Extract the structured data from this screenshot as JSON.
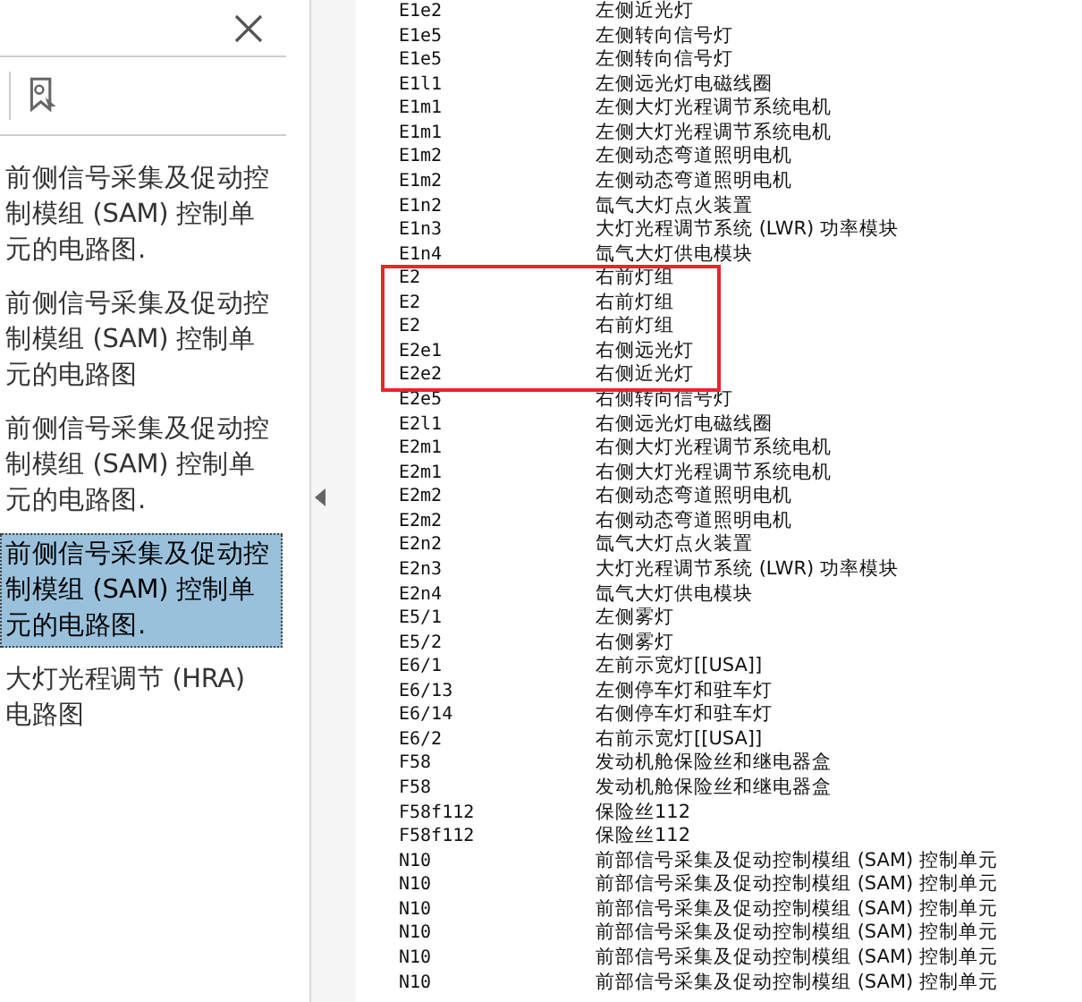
{
  "bookmarks_panel": {
    "items": [
      {
        "label": "前侧信号采集及促动控制模组 (SAM) 控制单元的电路图.",
        "selected": false
      },
      {
        "label": "前侧信号采集及促动控制模组 (SAM) 控制单元的电路图",
        "selected": false
      },
      {
        "label": "前侧信号采集及促动控制模组 (SAM) 控制单元的电路图.",
        "selected": false
      },
      {
        "label": "前侧信号采集及促动控制模组 (SAM) 控制单元的电路图.",
        "selected": true
      },
      {
        "label": "大灯光程调节 (HRA) 电路图",
        "selected": false
      }
    ]
  },
  "document": {
    "rows": [
      {
        "code": "E1e2",
        "name": "左侧近光灯",
        "highlighted": false
      },
      {
        "code": "E1e5",
        "name": "左侧转向信号灯",
        "highlighted": false
      },
      {
        "code": "E1e5",
        "name": "左侧转向信号灯",
        "highlighted": false
      },
      {
        "code": "E1l1",
        "name": "左侧远光灯电磁线圈",
        "highlighted": false
      },
      {
        "code": "E1m1",
        "name": "左侧大灯光程调节系统电机",
        "highlighted": false
      },
      {
        "code": "E1m1",
        "name": "左侧大灯光程调节系统电机",
        "highlighted": false
      },
      {
        "code": "E1m2",
        "name": "左侧动态弯道照明电机",
        "highlighted": false
      },
      {
        "code": "E1m2",
        "name": "左侧动态弯道照明电机",
        "highlighted": false
      },
      {
        "code": "E1n2",
        "name": "氙气大灯点火装置",
        "highlighted": false
      },
      {
        "code": "E1n3",
        "name": "大灯光程调节系统 (LWR) 功率模块",
        "highlighted": false
      },
      {
        "code": "E1n4",
        "name": "氙气大灯供电模块",
        "highlighted": false
      },
      {
        "code": "E2",
        "name": "右前灯组",
        "highlighted": true
      },
      {
        "code": "E2",
        "name": "右前灯组",
        "highlighted": true
      },
      {
        "code": "E2",
        "name": "右前灯组",
        "highlighted": true
      },
      {
        "code": "E2e1",
        "name": "右侧远光灯",
        "highlighted": true
      },
      {
        "code": "E2e2",
        "name": "右侧近光灯",
        "highlighted": true
      },
      {
        "code": "E2e5",
        "name": "右侧转向信号灯",
        "highlighted": false
      },
      {
        "code": "E2l1",
        "name": "右侧远光灯电磁线圈",
        "highlighted": false
      },
      {
        "code": "E2m1",
        "name": "右侧大灯光程调节系统电机",
        "highlighted": false
      },
      {
        "code": "E2m1",
        "name": "右侧大灯光程调节系统电机",
        "highlighted": false
      },
      {
        "code": "E2m2",
        "name": "右侧动态弯道照明电机",
        "highlighted": false
      },
      {
        "code": "E2m2",
        "name": "右侧动态弯道照明电机",
        "highlighted": false
      },
      {
        "code": "E2n2",
        "name": "氙气大灯点火装置",
        "highlighted": false
      },
      {
        "code": "E2n3",
        "name": "大灯光程调节系统 (LWR) 功率模块",
        "highlighted": false
      },
      {
        "code": "E2n4",
        "name": "氙气大灯供电模块",
        "highlighted": false
      },
      {
        "code": "E5/1",
        "name": "左侧雾灯",
        "highlighted": false
      },
      {
        "code": "E5/2",
        "name": "右侧雾灯",
        "highlighted": false
      },
      {
        "code": "E6/1",
        "name": "左前示宽灯[[USA]]",
        "highlighted": false
      },
      {
        "code": "E6/13",
        "name": "左侧停车灯和驻车灯",
        "highlighted": false
      },
      {
        "code": "E6/14",
        "name": "右侧停车灯和驻车灯",
        "highlighted": false
      },
      {
        "code": "E6/2",
        "name": "右前示宽灯[[USA]]",
        "highlighted": false
      },
      {
        "code": "F58",
        "name": "发动机舱保险丝和继电器盒",
        "highlighted": false
      },
      {
        "code": "F58",
        "name": "发动机舱保险丝和继电器盒",
        "highlighted": false
      },
      {
        "code": "F58f112",
        "name": "保险丝112",
        "highlighted": false
      },
      {
        "code": "F58f112",
        "name": "保险丝112",
        "highlighted": false
      },
      {
        "code": "N10",
        "name": "前部信号采集及促动控制模组 (SAM) 控制单元",
        "highlighted": false
      },
      {
        "code": "N10",
        "name": "前部信号采集及促动控制模组 (SAM) 控制单元",
        "highlighted": false
      },
      {
        "code": "N10",
        "name": "前部信号采集及促动控制模组 (SAM) 控制单元",
        "highlighted": false
      },
      {
        "code": "N10",
        "name": "前部信号采集及促动控制模组 (SAM) 控制单元",
        "highlighted": false
      },
      {
        "code": "N10",
        "name": "前部信号采集及促动控制模组 (SAM) 控制单元",
        "highlighted": false
      },
      {
        "code": "N10",
        "name": "前部信号采集及促动控制模组 (SAM) 控制单元",
        "highlighted": false
      }
    ]
  }
}
